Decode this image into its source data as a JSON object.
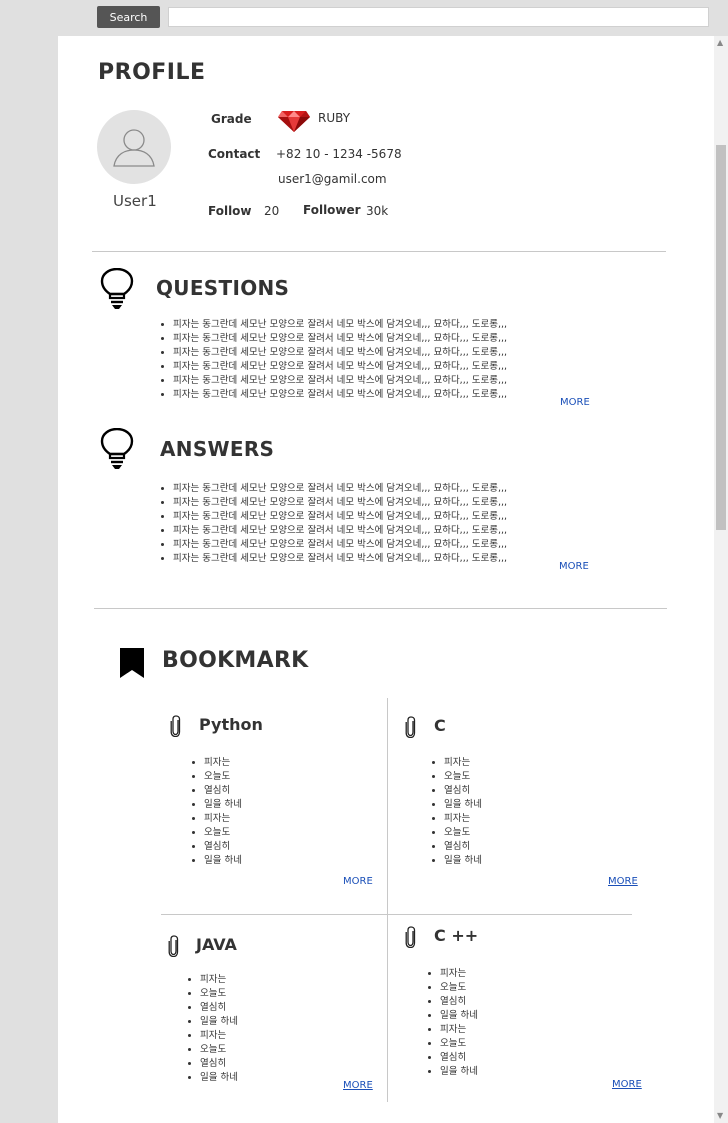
{
  "search": {
    "button_label": "Search",
    "value": ""
  },
  "profile": {
    "title": "PROFILE",
    "username": "User1",
    "grade_label": "Grade",
    "grade_value": "RUBY",
    "contact_label": "Contact",
    "phone": "+82 10 - 1234 -5678",
    "email": "user1@gamil.com",
    "follow_label": "Follow",
    "follow_count": "20",
    "follower_label": "Follower",
    "follower_count": "30k"
  },
  "questions": {
    "title": "QUESTIONS",
    "items": [
      "피자는 동그란데 세모난 모양으로 잘려서 네모 박스에 담겨오네,,, 묘하다,,, 도로롱,,,",
      "피자는 동그란데 세모난 모양으로 잘려서 네모 박스에 담겨오네,,, 묘하다,,, 도로롱,,,",
      "피자는 동그란데 세모난 모양으로 잘려서 네모 박스에 담겨오네,,, 묘하다,,, 도로롱,,,",
      "피자는 동그란데 세모난 모양으로 잘려서 네모 박스에 담겨오네,,, 묘하다,,, 도로롱,,,",
      "피자는 동그란데 세모난 모양으로 잘려서 네모 박스에 담겨오네,,, 묘하다,,, 도로롱,,,",
      "피자는 동그란데 세모난 모양으로 잘려서 네모 박스에 담겨오네,,, 묘하다,,, 도로롱,,,"
    ],
    "more": "MORE"
  },
  "answers": {
    "title": "ANSWERS",
    "items": [
      "피자는 동그란데 세모난 모양으로 잘려서 네모 박스에 담겨오네,,, 묘하다,,, 도로롱,,,",
      "피자는 동그란데 세모난 모양으로 잘려서 네모 박스에 담겨오네,,, 묘하다,,, 도로롱,,,",
      "피자는 동그란데 세모난 모양으로 잘려서 네모 박스에 담겨오네,,, 묘하다,,, 도로롱,,,",
      "피자는 동그란데 세모난 모양으로 잘려서 네모 박스에 담겨오네,,, 묘하다,,, 도로롱,,,",
      "피자는 동그란데 세모난 모양으로 잘려서 네모 박스에 담겨오네,,, 묘하다,,, 도로롱,,,",
      "피자는 동그란데 세모난 모양으로 잘려서 네모 박스에 담겨오네,,, 묘하다,,, 도로롱,,,"
    ],
    "more": "MORE"
  },
  "bookmark": {
    "title": "BOOKMARK",
    "groups": [
      {
        "title": "Python",
        "items": [
          "피자는",
          "오늘도",
          "열심히",
          "일을 하네",
          "피자는",
          "오늘도",
          "열심히",
          "일을 하네"
        ],
        "more": "MORE"
      },
      {
        "title": "C",
        "items": [
          "피자는",
          "오늘도",
          "열심히",
          "일을 하네",
          "피자는",
          "오늘도",
          "열심히",
          "일을 하네"
        ],
        "more": "MORE"
      },
      {
        "title": "JAVA",
        "items": [
          "피자는",
          "오늘도",
          "열심히",
          "일을 하네",
          "피자는",
          "오늘도",
          "열심히",
          "일을 하네"
        ],
        "more": "MORE"
      },
      {
        "title": "C ++",
        "items": [
          "피자는",
          "오늘도",
          "열심히",
          "일을 하네",
          "피자는",
          "오늘도",
          "열심히",
          "일을 하네"
        ],
        "more": "MORE"
      }
    ]
  },
  "icons": {
    "ruby": "ruby-gem-icon",
    "avatar": "user-avatar-icon",
    "questions": "lightbulb-icon",
    "answers": "lightbulb-icon",
    "bookmark": "bookmark-icon",
    "group": "paperclip-icon"
  },
  "colors": {
    "link": "#1a4fb8",
    "ruby": "#d81e1e",
    "search_button": "#555555"
  }
}
